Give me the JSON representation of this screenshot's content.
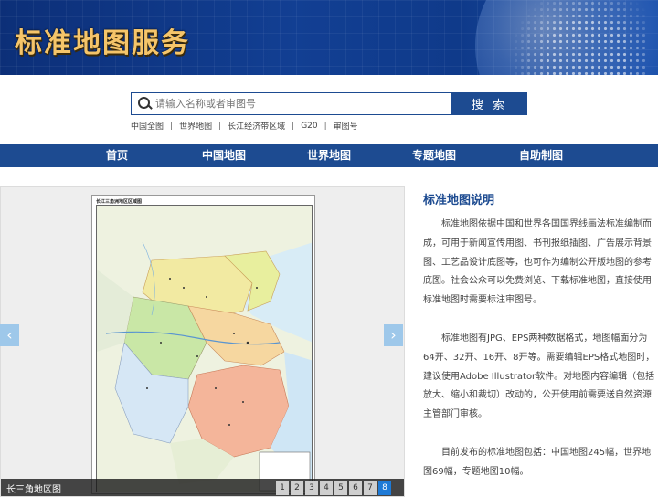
{
  "banner": {
    "title": "标准地图服务"
  },
  "search": {
    "placeholder": "请输入名称或者审图号",
    "button_label": "搜 索"
  },
  "quick_links": [
    "中国全图",
    "世界地图",
    "长江经济带区域",
    "G20",
    "审图号"
  ],
  "nav": [
    "首页",
    "中国地图",
    "世界地图",
    "专题地图",
    "自助制图"
  ],
  "carousel": {
    "map_title": "长江三角洲地区区域图",
    "caption": "长三角地区图",
    "pages": [
      "1",
      "2",
      "3",
      "4",
      "5",
      "6",
      "7",
      "8"
    ],
    "active_page": "8",
    "prev_label": "‹",
    "next_label": "›"
  },
  "description": {
    "title": "标准地图说明",
    "paragraphs": [
      "标准地图依据中国和世界各国国界线画法标准编制而成，可用于新闻宣传用图、书刊报纸插图、广告展示背景图、工艺品设计底图等，也可作为编制公开版地图的参考底图。社会公众可以免费浏览、下载标准地图，直接使用标准地图时需要标注审图号。",
      "标准地图有JPG、EPS两种数据格式，地图幅面分为64开、32开、16开、8开等。需要编辑EPS格式地图时，建议使用Adobe Illustrator软件。对地图内容编辑（包括放大、缩小和裁切）改动的，公开使用前需要送自然资源主管部门审核。",
      "目前发布的标准地图包括：中国地图245幅，世界地图69幅，专题地图10幅。"
    ]
  },
  "colors": {
    "primary": "#1d4b91",
    "active_page": "#1e7ad6",
    "title_gold": "#f5c56a"
  }
}
